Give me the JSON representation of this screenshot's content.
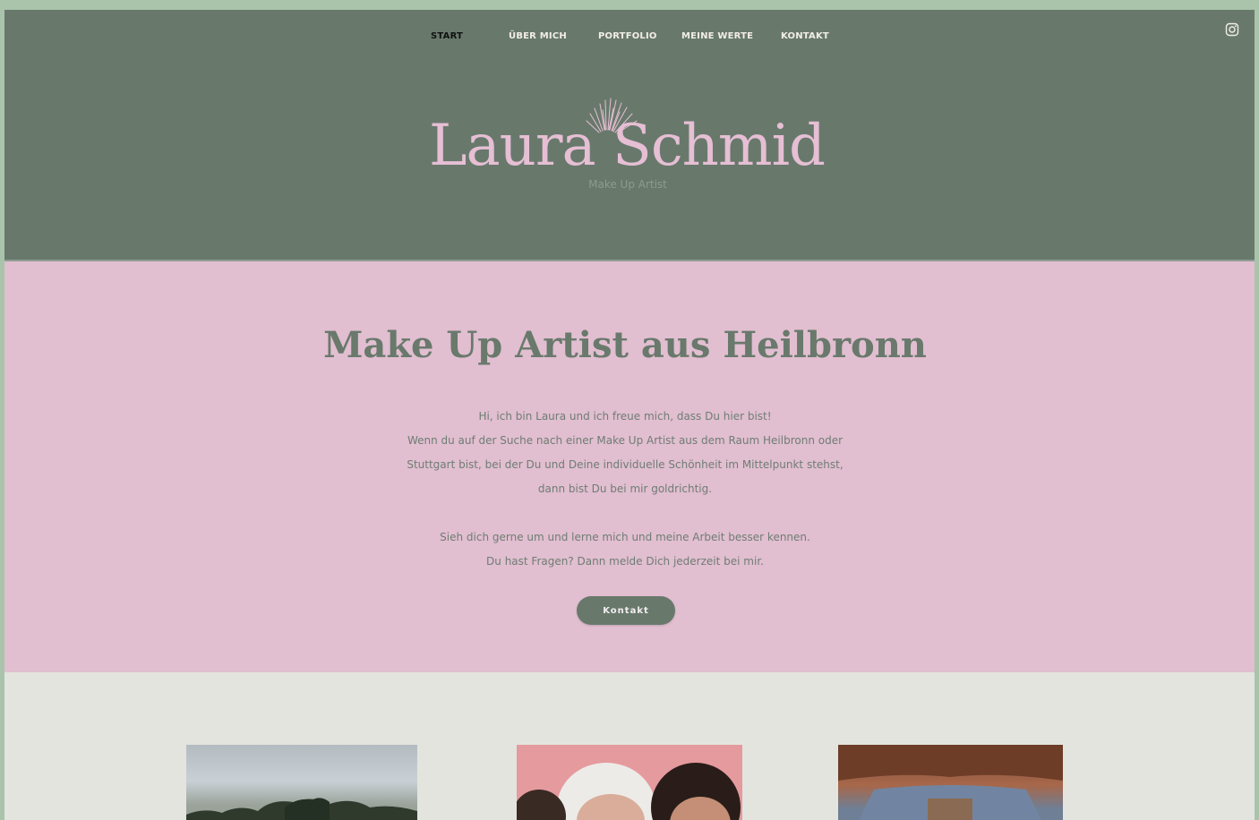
{
  "nav": {
    "items": [
      {
        "label": "START",
        "active": true
      },
      {
        "label": "ÜBER MICH",
        "active": false
      },
      {
        "label": "PORTFOLIO",
        "active": false
      },
      {
        "label": "MEINE WERTE",
        "active": false
      },
      {
        "label": "KONTAKT",
        "active": false
      }
    ],
    "social_icon": "instagram-icon"
  },
  "logo": {
    "name": "Laura Schmid",
    "tagline": "Make Up Artist",
    "emblem_icon": "sunburst-icon"
  },
  "intro": {
    "title": "Make Up Artist aus Heilbronn",
    "paragraph1": [
      "Hi, ich bin Laura und ich freue mich, dass Du hier bist!",
      "Wenn du auf der Suche nach einer Make Up Artist aus dem Raum Heilbronn oder",
      "Stuttgart bist, bei der Du und Deine individuelle Schönheit im Mittelpunkt stehst,",
      "dann bist Du bei mir goldrichtig."
    ],
    "paragraph2": [
      "Sieh dich gerne um und lerne mich und meine Arbeit besser kennen.",
      "Du hast Fragen? Dann melde Dich jederzeit bei mir."
    ],
    "cta_label": "Kontakt"
  },
  "colors": {
    "header_bg": "#68796c",
    "intro_bg": "#e1bed0",
    "gallery_bg": "#e4e4de",
    "logo_pink": "#e6bfd4",
    "accent_green": "#68796c"
  }
}
